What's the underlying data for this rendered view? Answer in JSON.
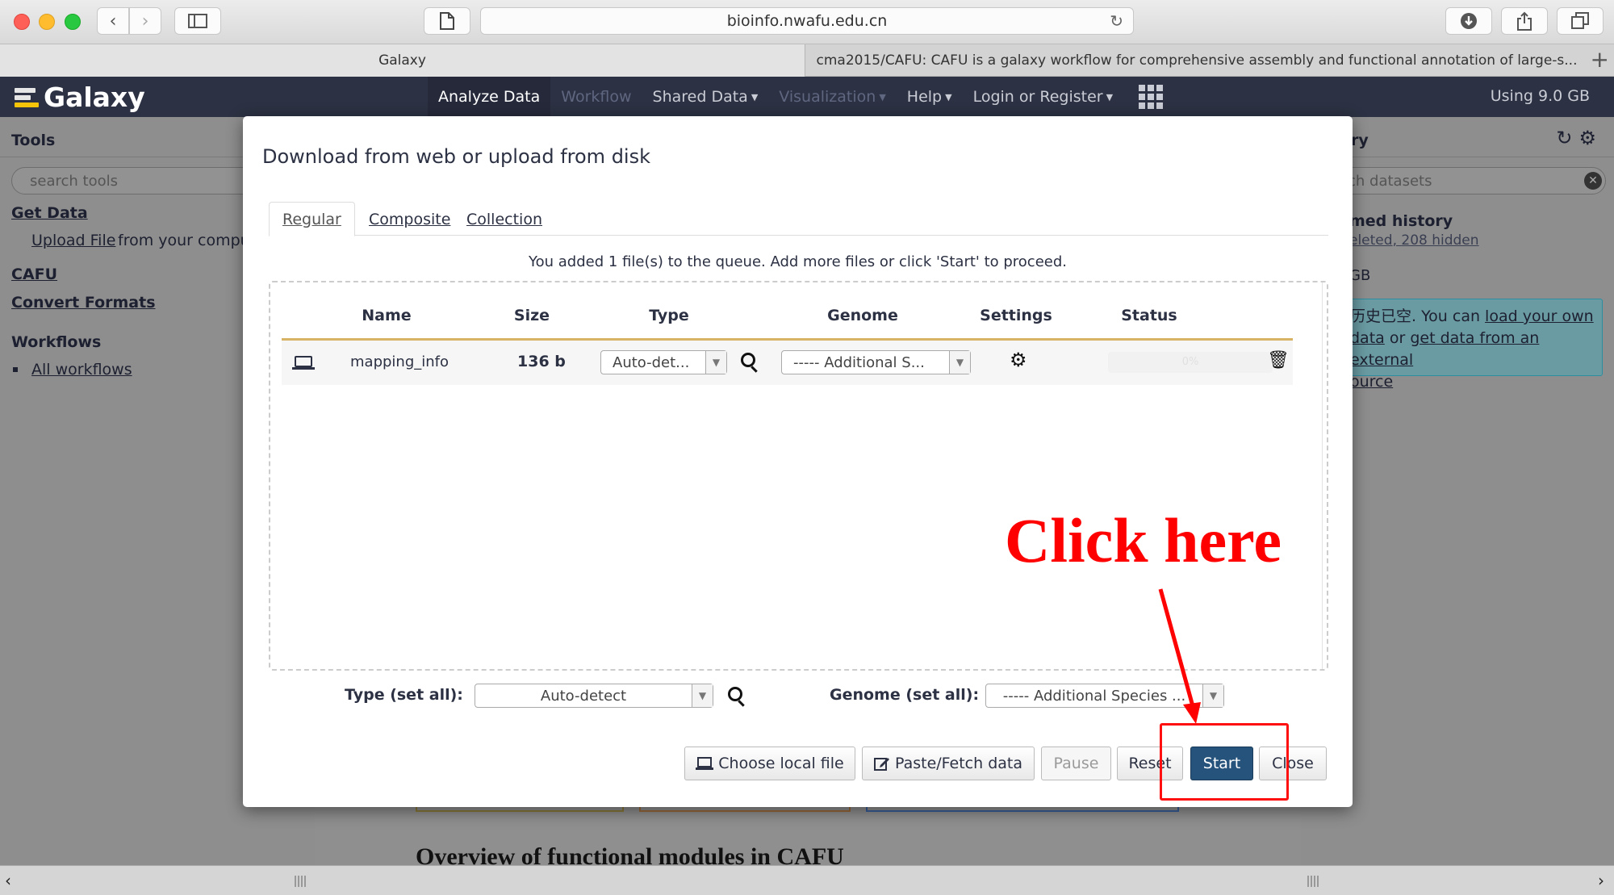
{
  "browser": {
    "url": "bioinfo.nwafu.edu.cn",
    "tabs": [
      "Galaxy",
      "cma2015/CAFU: CAFU is a galaxy workflow for comprehensive assembly and functional annotation of large-s..."
    ]
  },
  "masthead": {
    "brand": "Galaxy",
    "nav": [
      "Analyze Data",
      "Workflow",
      "Shared Data",
      "Visualization",
      "Help",
      "Login or Register"
    ],
    "usage": "Using 9.0 GB"
  },
  "tool_panel": {
    "title": "Tools",
    "search_placeholder": "search tools",
    "get_data": "Get Data",
    "upload_link": "Upload File",
    "upload_suffix": "from your compu",
    "cafu": "CAFU",
    "convert": "Convert Formats",
    "workflows_heading": "Workflows",
    "all_workflows": "All workflows"
  },
  "history_panel": {
    "title_fragment": "ry",
    "search_placeholder": "rch datasets",
    "history_name": "med history",
    "deleted": "eleted",
    "hidden": "208 hidden",
    "size": "GB",
    "empty_prefix": "历史已空. You can",
    "load_link": "load your own",
    "data_word": "data",
    "or_text": "or",
    "external_link": "get data from an external",
    "source_word": "ource"
  },
  "center": {
    "overview_title": "Overview of functional modules in CAFU"
  },
  "upload_dialog": {
    "title": "Download from web or upload from disk",
    "tabs": [
      "Regular",
      "Composite",
      "Collection"
    ],
    "queue_message": "You added 1 file(s) to the queue. Add more files or click 'Start' to proceed.",
    "columns": [
      "Name",
      "Size",
      "Type",
      "Genome",
      "Settings",
      "Status"
    ],
    "row": {
      "name": "mapping_info",
      "size": "136 b",
      "type": "Auto-det...",
      "genome": "----- Additional S...",
      "progress": "0%"
    },
    "type_set_all_label": "Type (set all):",
    "type_set_all_value": "Auto-detect",
    "genome_set_all_label": "Genome (set all):",
    "genome_set_all_value": "----- Additional Species ...",
    "buttons": {
      "choose_local": "Choose local file",
      "paste_fetch": "Paste/Fetch data",
      "pause": "Pause",
      "reset": "Reset",
      "start": "Start",
      "close": "Close"
    }
  },
  "annotation": {
    "text": "Click here",
    "color": "#ff0000"
  },
  "colors": {
    "masthead": "#2c3143",
    "primary_button": "#25537b",
    "row_underline": "#d8b365"
  }
}
